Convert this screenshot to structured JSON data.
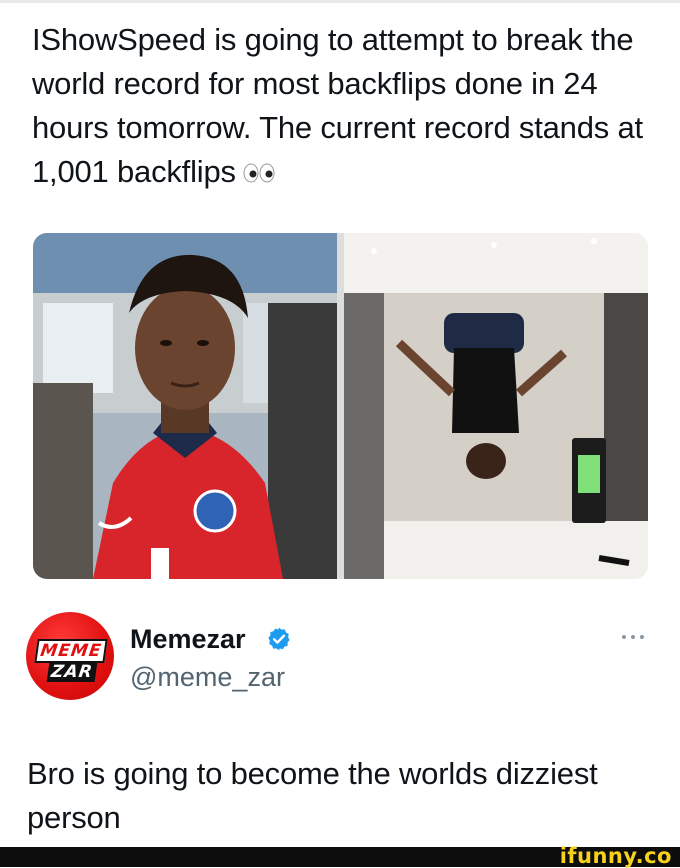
{
  "quoted_post": {
    "text": "IShowSpeed is going to attempt to break the world record for most backflips done in 24 hours tomorrow. The current record stands at 1,001 backflips",
    "emoji": "eyes-emoji"
  },
  "media": {
    "left_photo": "photo-person-in-red-jersey",
    "right_photo": "photo-person-mid-backflip"
  },
  "author": {
    "display_name": "Memezar",
    "handle": "@meme_zar",
    "verified": true,
    "avatar_text_top": "MEME",
    "avatar_text_bottom": "ZAR"
  },
  "post": {
    "text": "Bro is going to become the worlds dizziest person"
  },
  "watermark": "ifunny.co",
  "colors": {
    "verified_blue": "#1d9bf0",
    "avatar_red": "#e01010",
    "handle_gray": "#536471",
    "watermark_yellow": "#f7d21c"
  }
}
